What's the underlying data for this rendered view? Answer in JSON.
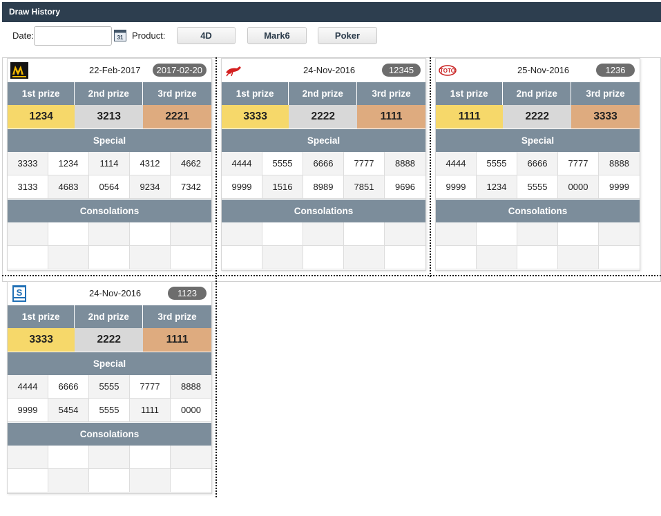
{
  "window": {
    "title": "Draw History"
  },
  "toolbar": {
    "date_label": "Date:",
    "date_value": "",
    "product_label": "Product:",
    "buttons": [
      "4D",
      "Mark6",
      "Poker"
    ]
  },
  "labels": {
    "first": "1st prize",
    "second": "2nd prize",
    "third": "3rd prize",
    "special": "Special",
    "consolations": "Consolations"
  },
  "cards": [
    {
      "logo": "magnum-logo-icon",
      "date": "22-Feb-2017",
      "draw_no": "2017-02-20",
      "prizes": [
        "1234",
        "3213",
        "2221"
      ],
      "special": [
        "3333",
        "1234",
        "1114",
        "4312",
        "4662",
        "3133",
        "4683",
        "0564",
        "9234",
        "7342"
      ],
      "consolations": [
        "",
        "",
        "",
        "",
        "",
        "",
        "",
        "",
        "",
        ""
      ]
    },
    {
      "logo": "da-ma-cai-horse-logo-icon",
      "date": "24-Nov-2016",
      "draw_no": "12345",
      "prizes": [
        "3333",
        "2222",
        "1111"
      ],
      "special": [
        "4444",
        "5555",
        "6666",
        "7777",
        "8888",
        "9999",
        "1516",
        "8989",
        "7851",
        "9696"
      ],
      "consolations": [
        "",
        "",
        "",
        "",
        "",
        "",
        "",
        "",
        "",
        ""
      ]
    },
    {
      "logo": "toto-logo-icon",
      "date": "25-Nov-2016",
      "draw_no": "1236",
      "prizes": [
        "1111",
        "2222",
        "3333"
      ],
      "special": [
        "4444",
        "5555",
        "6666",
        "7777",
        "8888",
        "9999",
        "1234",
        "5555",
        "0000",
        "9999"
      ],
      "consolations": [
        "",
        "",
        "",
        "",
        "",
        "",
        "",
        "",
        "",
        ""
      ]
    },
    {
      "logo": "singapore-pools-logo-icon",
      "date": "24-Nov-2016",
      "draw_no": "1123",
      "prizes": [
        "3333",
        "2222",
        "1111"
      ],
      "special": [
        "4444",
        "6666",
        "5555",
        "7777",
        "8888",
        "9999",
        "5454",
        "5555",
        "1111",
        "0000"
      ],
      "consolations": [
        "",
        "",
        "",
        "",
        "",
        "",
        "",
        "",
        "",
        ""
      ]
    }
  ],
  "colors": {
    "titlebar": "#2d3e4f",
    "header": "#7c8d9b",
    "first_prize": "#f6d86a",
    "second_prize": "#d8d8d8",
    "third_prize": "#deab7f"
  }
}
